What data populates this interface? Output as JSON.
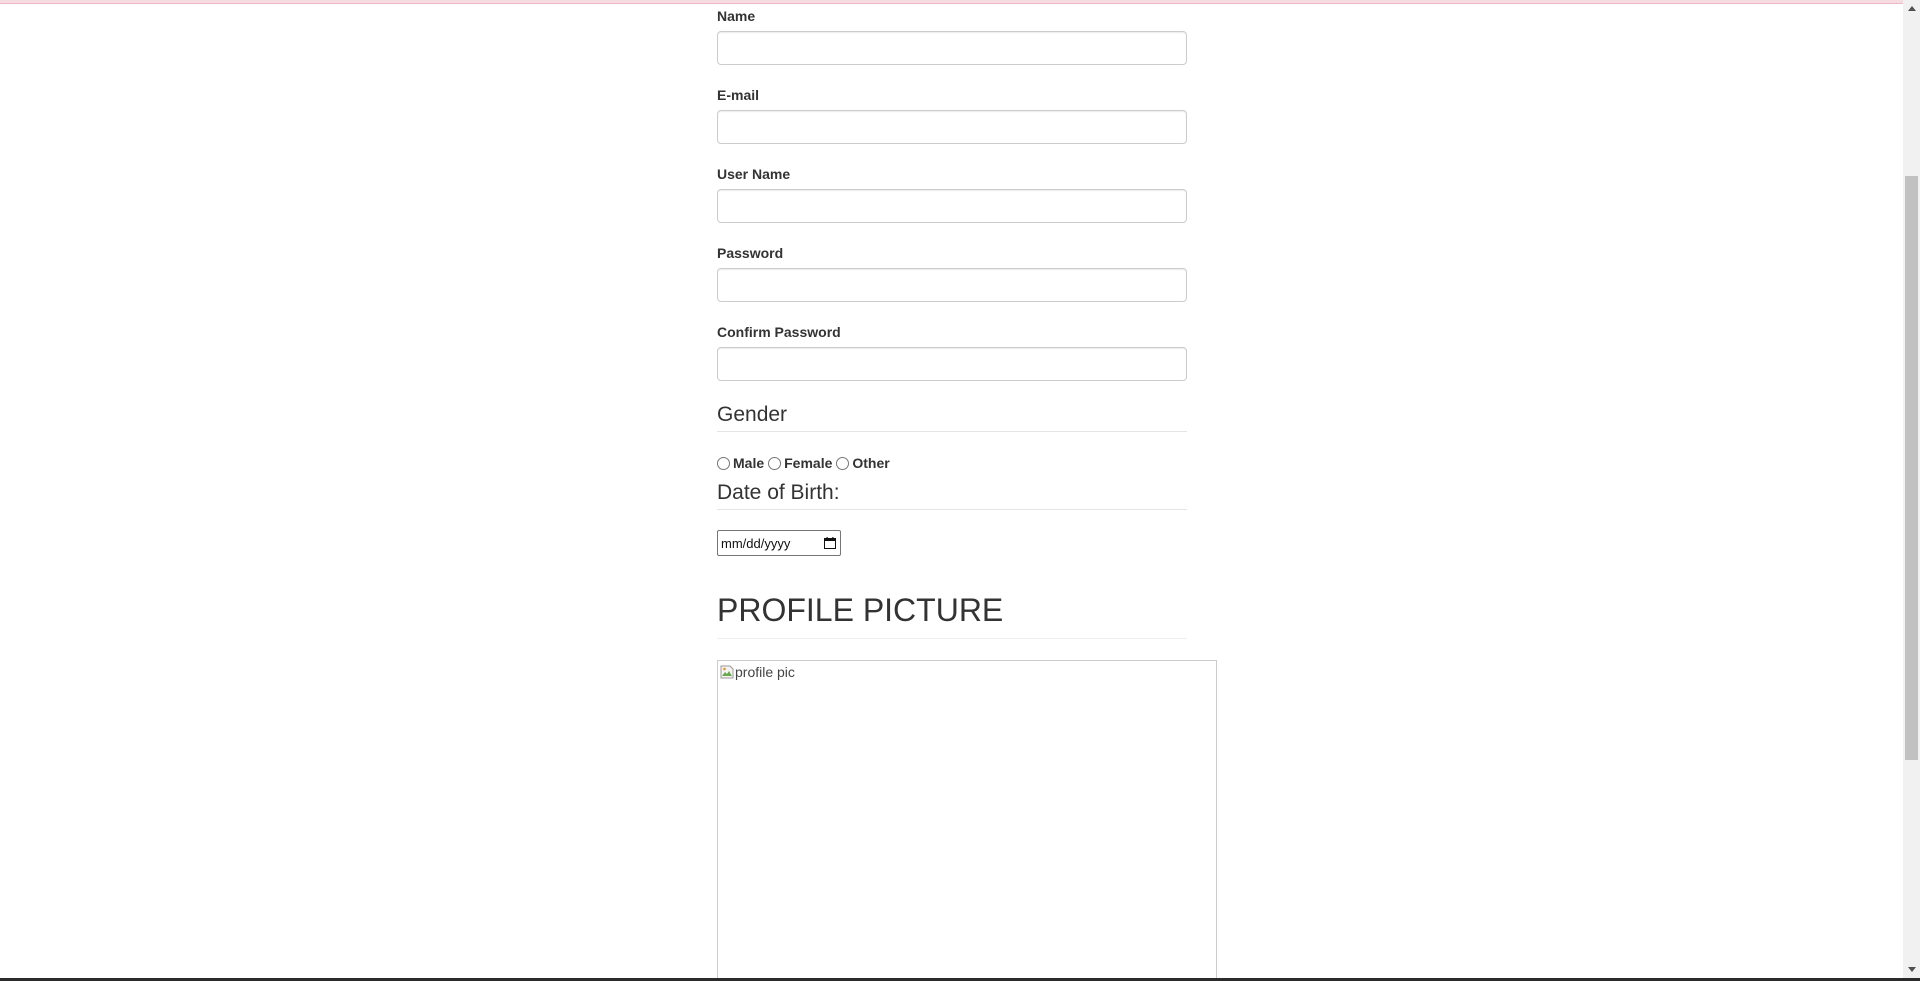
{
  "form": {
    "name_label": "Name",
    "name_value": "",
    "email_label": "E-mail",
    "email_value": "",
    "username_label": "User Name",
    "username_value": "",
    "password_label": "Password",
    "password_value": "",
    "confirm_label": "Confirm Password",
    "confirm_value": "",
    "gender_heading": "Gender",
    "gender_options": [
      "Male",
      "Female",
      "Other"
    ],
    "dob_heading": "Date of Birth:",
    "dob_placeholder": "mm/dd/yyyy"
  },
  "profile": {
    "heading": "PROFILE PICTURE",
    "image_alt": "profile pic"
  },
  "icons": {
    "date_picker": "calendar-icon",
    "broken_image": "broken-image-icon",
    "scroll_up": "scroll-up-arrow-icon",
    "scroll_down": "scroll-down-arrow-icon"
  },
  "colors": {
    "top_accent": "#f6dbe3",
    "text": "#333333",
    "input_border": "#cccccc"
  }
}
